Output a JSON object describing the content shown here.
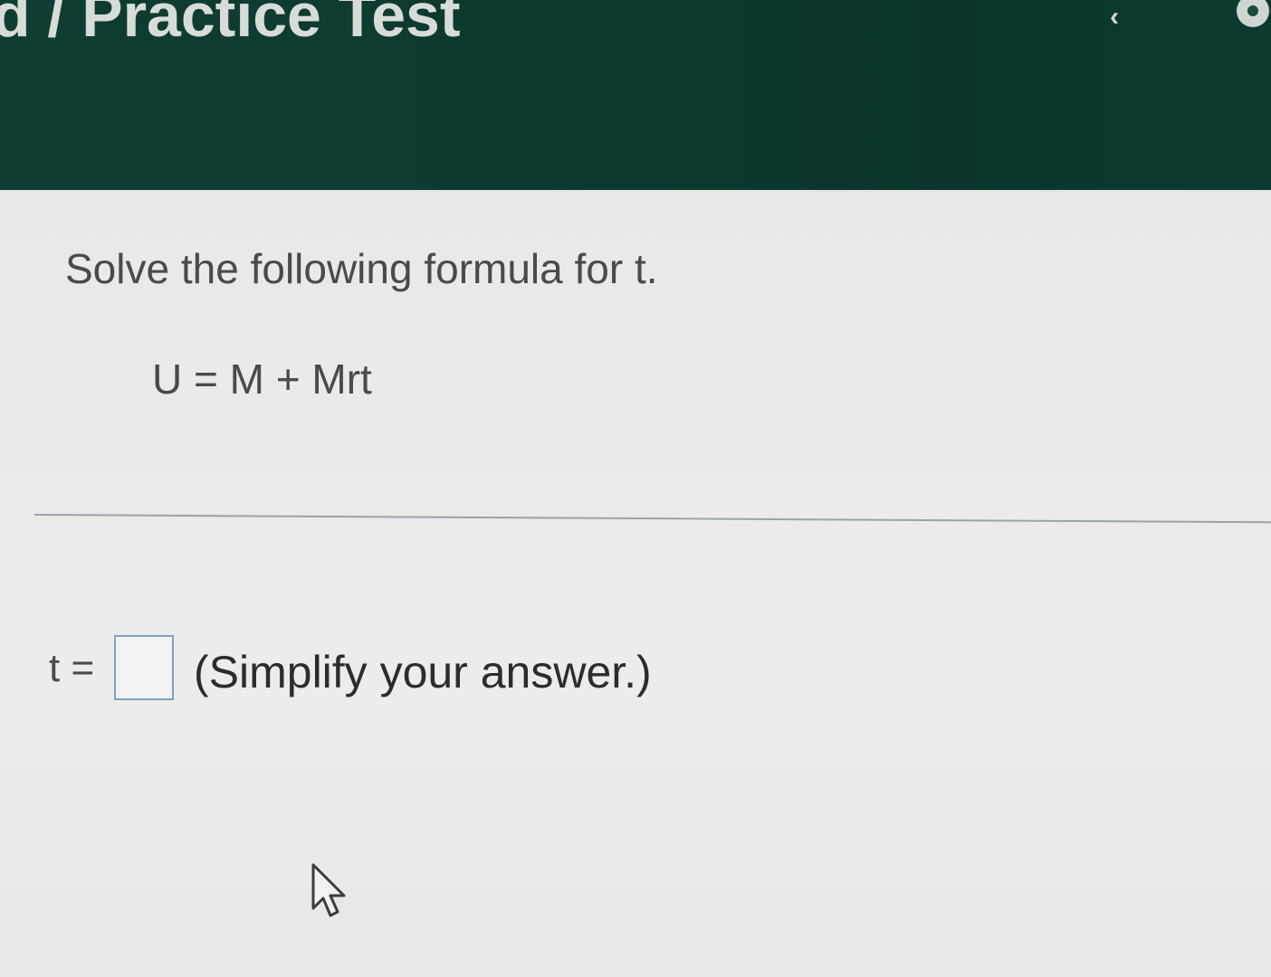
{
  "header": {
    "title": "d / Practice Test"
  },
  "question": {
    "instruction": "Solve the following formula for t.",
    "formula": "U = M + Mrt"
  },
  "answer": {
    "label": "t =",
    "value": "",
    "hint": "(Simplify your answer.)"
  },
  "icons": {
    "prev": "chevron-left-icon",
    "next": "circle-icon",
    "pointer": "mouse-pointer-icon"
  },
  "colors": {
    "header_bg": "#0d3a30",
    "input_border": "#7fa2c2"
  }
}
